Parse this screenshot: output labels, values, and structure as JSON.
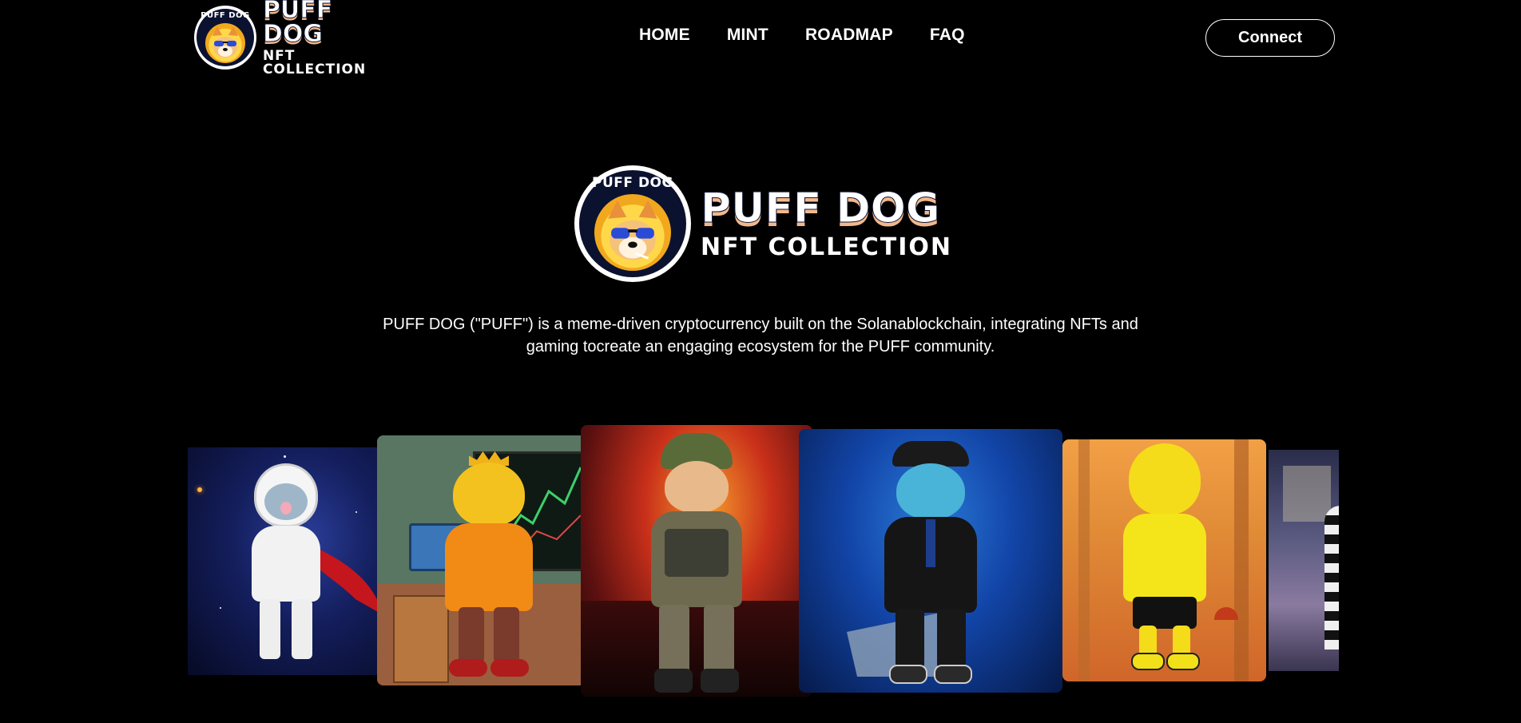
{
  "nav": {
    "logo": {
      "ring_text": "PUFF DOG",
      "title": "PUFF DOG",
      "subtitle": "NFT COLLECTION"
    },
    "links": [
      "HOME",
      "MINT",
      "ROADMAP",
      "FAQ"
    ],
    "connect_label": "Connect"
  },
  "hero": {
    "logo": {
      "ring_text": "PUFF DOG",
      "title": "PUFF DOG",
      "subtitle": "NFT COLLECTION"
    },
    "description_line1": "PUFF DOG (\"PUFF\") is a meme-driven cryptocurrency built on the Solanablockchain, integrating NFTs and",
    "description_line2": "gaming tocreate an engaging ecosystem for the PUFF community."
  },
  "gallery": {
    "cards": [
      {
        "name": "astronaut-dog",
        "theme": "space"
      },
      {
        "name": "crowned-trader-dog",
        "theme": "office"
      },
      {
        "name": "soldier-dog",
        "theme": "war"
      },
      {
        "name": "pilot-dog",
        "theme": "ocean"
      },
      {
        "name": "yellow-hoodie-dog",
        "theme": "forest"
      },
      {
        "name": "wanted-dog",
        "theme": "smoke"
      }
    ]
  },
  "colors": {
    "background": "#000000",
    "text": "#ffffff",
    "logo_navy": "#0b1230",
    "logo_orange": "#f2a81e"
  }
}
